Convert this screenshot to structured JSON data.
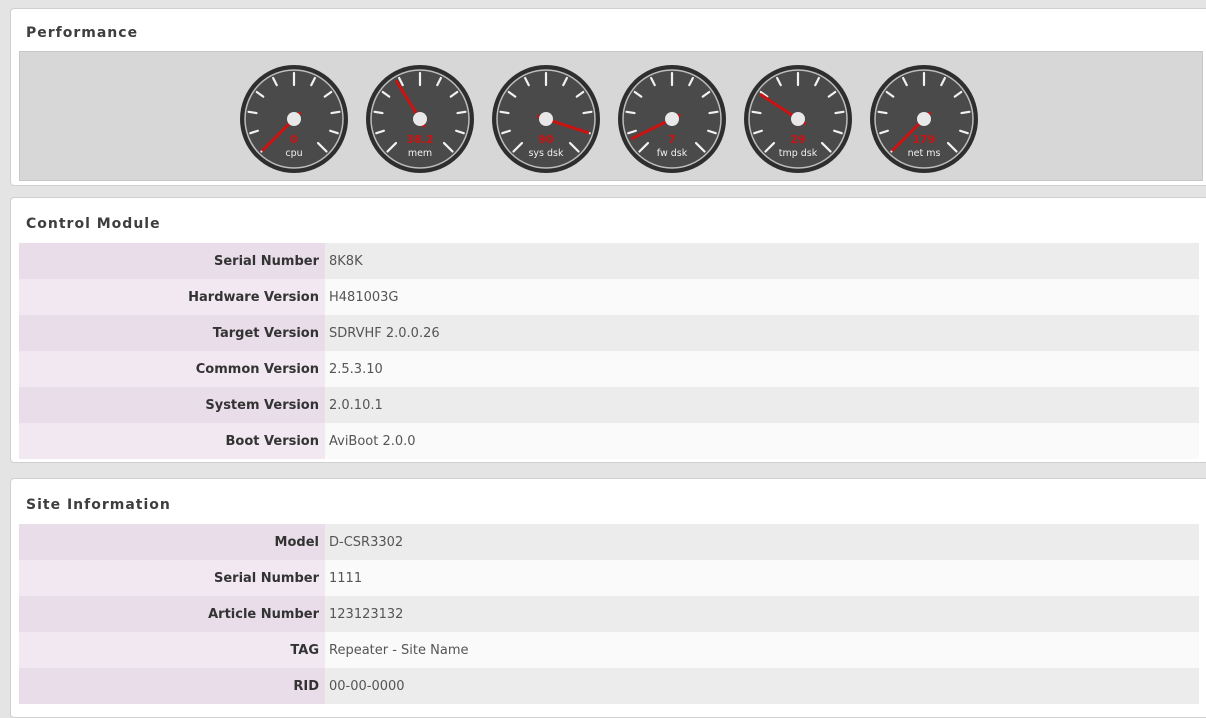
{
  "performance": {
    "title": "Performance",
    "gauges": [
      {
        "value": "0",
        "label": "cpu",
        "level": 0.0
      },
      {
        "value": "38.2",
        "label": "mem",
        "level": 0.382
      },
      {
        "value": "90",
        "label": "sys dsk",
        "level": 0.9
      },
      {
        "value": "7",
        "label": "fw dsk",
        "level": 0.07
      },
      {
        "value": "29",
        "label": "tmp dsk",
        "level": 0.29
      },
      {
        "value": "179",
        "label": "net ms",
        "level": 0.0
      }
    ]
  },
  "control_module": {
    "title": "Control Module",
    "rows": [
      {
        "key": "Serial Number",
        "value": "8K8K"
      },
      {
        "key": "Hardware Version",
        "value": "H481003G"
      },
      {
        "key": "Target Version",
        "value": "SDRVHF 2.0.0.26"
      },
      {
        "key": "Common Version",
        "value": "2.5.3.10"
      },
      {
        "key": "System Version",
        "value": "2.0.10.1"
      },
      {
        "key": "Boot Version",
        "value": "AviBoot 2.0.0"
      }
    ]
  },
  "site_information": {
    "title": "Site Information",
    "rows": [
      {
        "key": "Model",
        "value": "D-CSR3302"
      },
      {
        "key": "Serial Number",
        "value": "1111"
      },
      {
        "key": "Article Number",
        "value": "123123132"
      },
      {
        "key": "TAG",
        "value": "Repeater - Site Name"
      },
      {
        "key": "RID",
        "value": "00-00-0000"
      }
    ]
  },
  "colors": {
    "needle": "#cc1111",
    "gauge_face": "#4a4a4a",
    "gauge_rim": "#2e2e2e",
    "key_text": "#333333"
  }
}
